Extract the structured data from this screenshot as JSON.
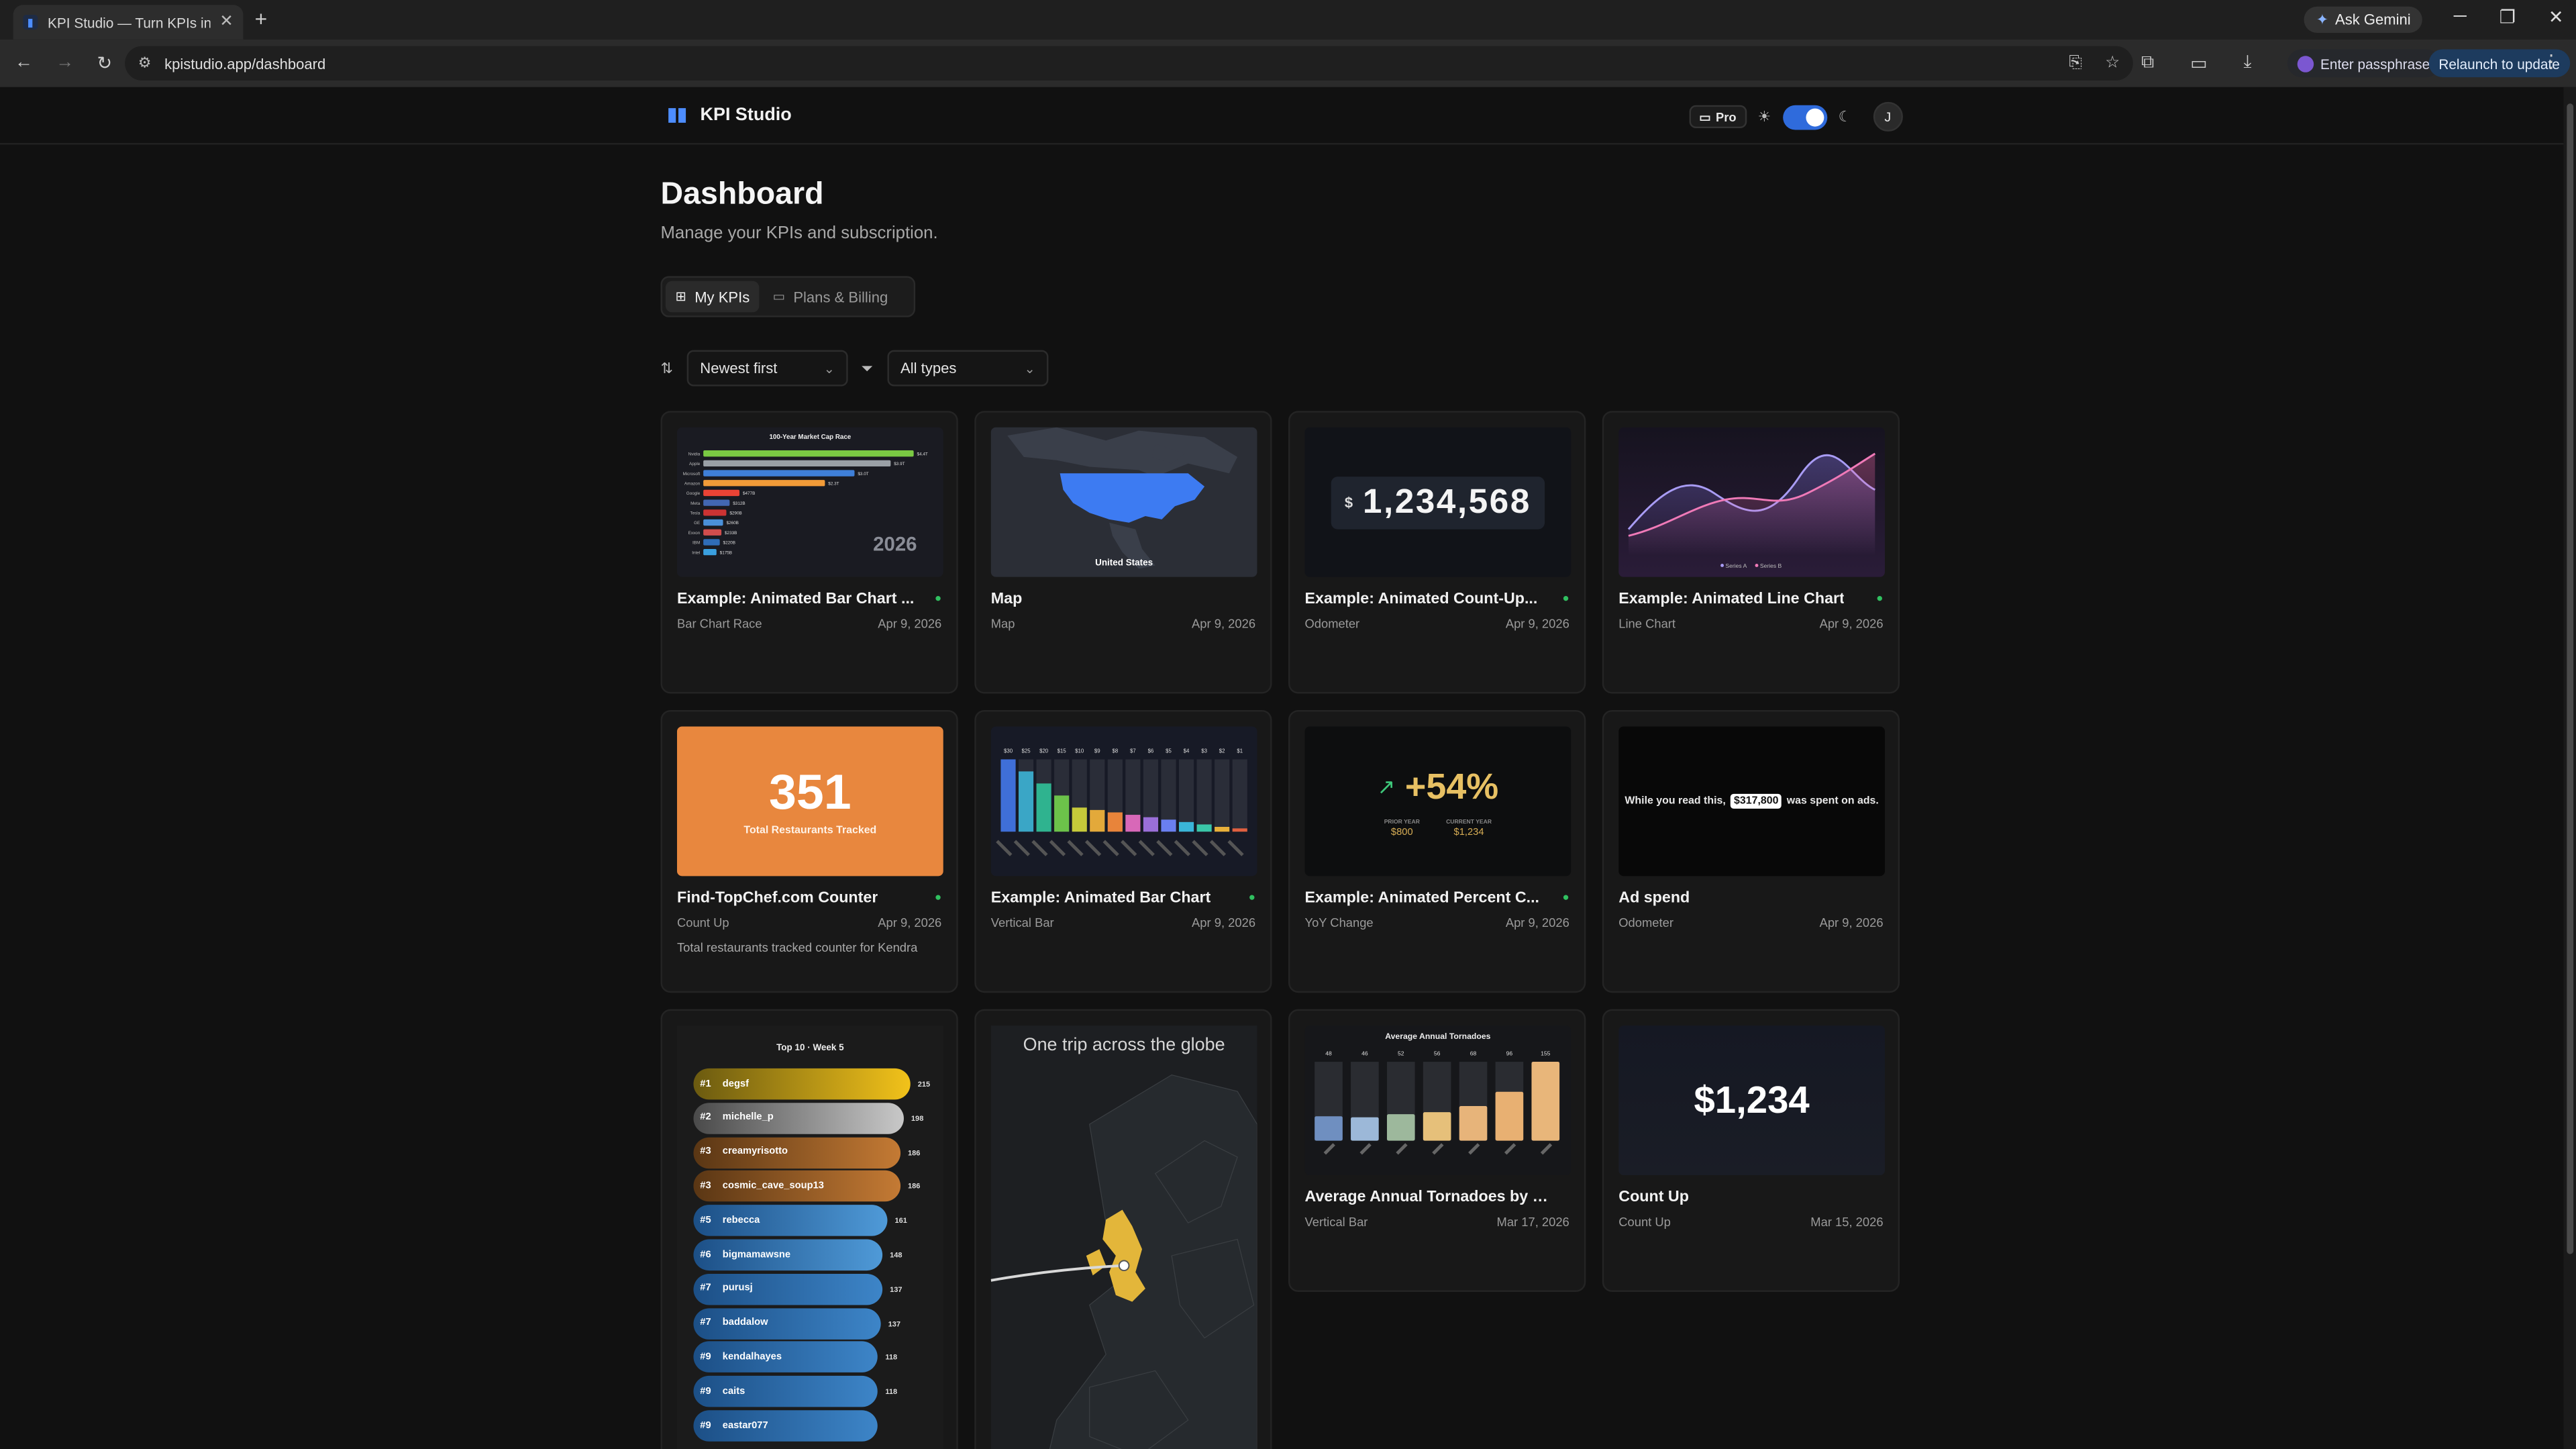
{
  "browser": {
    "tab_title": "KPI Studio — Turn KPIs into An",
    "tab_favicon": "kpi-logo-icon",
    "url": "kpistudio.app/dashboard",
    "ask_gemini": "Ask Gemini",
    "passphrase": "Enter passphrase",
    "relaunch": "Relaunch to update"
  },
  "header": {
    "brand": "KPI Studio",
    "plan_badge": "Pro",
    "avatar_initial": "J",
    "theme": "dark"
  },
  "page": {
    "title": "Dashboard",
    "subtitle": "Manage your KPIs and subscription."
  },
  "tabs": [
    {
      "label": "My KPIs",
      "icon": "grid-icon",
      "active": true
    },
    {
      "label": "Plans & Billing",
      "icon": "card-icon",
      "active": false
    }
  ],
  "filters": {
    "sort": "Newest first",
    "type": "All types"
  },
  "cards": [
    {
      "title": "Example: Animated Bar Chart ...",
      "type": "Bar Chart Race",
      "date": "Apr 9, 2026",
      "public": true,
      "thumb": {
        "title": "100-Year Market Cap Race",
        "year": "2026",
        "labels": [
          "Nvidia",
          "Apple",
          "Microsoft",
          "Amazon",
          "Google",
          "Meta",
          "Tesla",
          "GE",
          "Exxon",
          "IBM",
          "Intel"
        ],
        "values": [
          "$4.4T",
          "$3.9T",
          "$3.0T",
          "$2.3T",
          "$477B",
          "$312B",
          "$290B",
          "$260B",
          "$233B",
          "$220B",
          "$175B"
        ]
      }
    },
    {
      "title": "Map",
      "type": "Map",
      "date": "Apr 9, 2026",
      "public": false,
      "thumb": {
        "label": "United States"
      }
    },
    {
      "title": "Example: Animated Count-Up...",
      "type": "Odometer",
      "date": "Apr 9, 2026",
      "public": true,
      "thumb": {
        "currency": "$",
        "value": "1,234,568"
      }
    },
    {
      "title": "Example: Animated Line Chart",
      "type": "Line Chart",
      "date": "Apr 9, 2026",
      "public": true,
      "thumb": {
        "legend": [
          "Series A",
          "Series B"
        ]
      }
    },
    {
      "title": "Find-TopChef.com Counter",
      "type": "Count Up",
      "date": "Apr 9, 2026",
      "public": true,
      "description": "Total restaurants tracked counter for Kendra",
      "thumb": {
        "value": "351",
        "label": "Total Restaurants Tracked"
      }
    },
    {
      "title": "Example: Animated Bar Chart",
      "type": "Vertical Bar",
      "date": "Apr 9, 2026",
      "public": true,
      "thumb": {
        "values": [
          "$30",
          "$25",
          "$20",
          "$15",
          "$10",
          "$9",
          "$8",
          "$7",
          "$6",
          "$5",
          "$4",
          "$3",
          "$2",
          "$1"
        ]
      }
    },
    {
      "title": "Example: Animated Percent C...",
      "type": "YoY Change",
      "date": "Apr 9, 2026",
      "public": true,
      "thumb": {
        "value": "+54%",
        "prev_label": "PRIOR YEAR",
        "prev": "$800",
        "curr_label": "CURRENT YEAR",
        "curr": "$1,234"
      }
    },
    {
      "title": "Ad spend",
      "type": "Odometer",
      "date": "Apr 9, 2026",
      "public": false,
      "thumb": {
        "prefix": "While you read this,",
        "value": "$317,800",
        "suffix": "was spent on ads."
      }
    },
    {
      "title": "",
      "type": "",
      "date": "",
      "public": false,
      "thumb": {
        "title": "Top 10 · Week 5",
        "rows": [
          {
            "rank": "#1",
            "name": "degsf",
            "score": "215"
          },
          {
            "rank": "#2",
            "name": "michelle_p",
            "score": "198"
          },
          {
            "rank": "#3",
            "name": "creamyrisotto",
            "score": "186"
          },
          {
            "rank": "#3",
            "name": "cosmic_cave_soup13",
            "score": "186"
          },
          {
            "rank": "#5",
            "name": "rebecca",
            "score": "161"
          },
          {
            "rank": "#6",
            "name": "bigmamawsne",
            "score": "148"
          },
          {
            "rank": "#7",
            "name": "purusj",
            "score": "137"
          },
          {
            "rank": "#7",
            "name": "baddalow",
            "score": "137"
          },
          {
            "rank": "#9",
            "name": "kendalhayes",
            "score": "118"
          },
          {
            "rank": "#9",
            "name": "caits",
            "score": "118"
          },
          {
            "rank": "#9",
            "name": "eastar077",
            "score": ""
          }
        ]
      }
    },
    {
      "title": "",
      "type": "",
      "date": "",
      "public": false,
      "thumb": {
        "caption": "One trip across the globe"
      }
    },
    {
      "title": "Average Annual Tornadoes by S...",
      "type": "Vertical Bar",
      "date": "Mar 17, 2026",
      "public": false,
      "thumb": {
        "title": "Average Annual Tornadoes",
        "values": [
          "48",
          "46",
          "52",
          "56",
          "68",
          "96",
          "155"
        ]
      }
    },
    {
      "title": "Count Up",
      "type": "Count Up",
      "date": "Mar 15, 2026",
      "public": false,
      "thumb": {
        "value": "$1,234"
      }
    }
  ]
}
